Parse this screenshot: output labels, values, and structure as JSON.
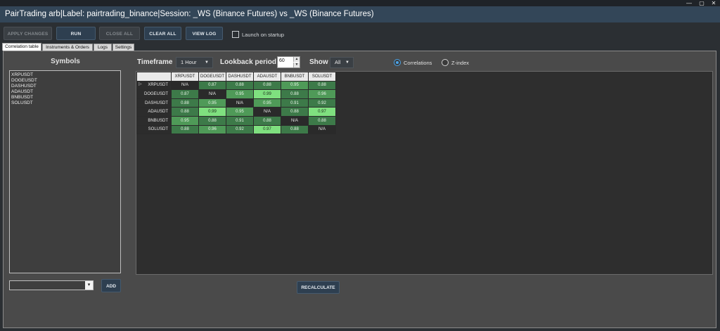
{
  "window": {
    "title": "PairTrading arb|Label: pairtrading_binance|Session: _WS (Binance Futures) vs _WS (Binance Futures)",
    "minimize": "—",
    "maximize": "▢",
    "close": "✕"
  },
  "toolbar": {
    "apply_changes": "APPLY CHANGES",
    "run": "RUN",
    "close_all": "CLOSE ALL",
    "clear_all": "CLEAR ALL",
    "view_log": "VIEW LOG",
    "launch_on_startup": "Launch on startup",
    "launch_on_startup_checked": false
  },
  "tabs": [
    "Correlation table",
    "Instruments & Orders",
    "Logs",
    "Settings"
  ],
  "active_tab": "Correlation table",
  "symbols": {
    "title": "Symbols",
    "items": [
      "XRPUSDT",
      "DOGEUSDT",
      "DASHUSDT",
      "ADAUSDT",
      "BNBUSDT",
      "SOLUSDT"
    ],
    "combo_value": "",
    "add_label": "ADD"
  },
  "controls": {
    "timeframe_label": "Timeframe",
    "timeframe_value": "1 Hour",
    "lookback_label": "Lookback period",
    "lookback_value": "60",
    "show_label": "Show",
    "show_value": "All",
    "mode_options": [
      "Correlations",
      "Z-index"
    ],
    "mode_selected": "Correlations",
    "recalculate": "RECALCULATE"
  },
  "matrix": {
    "columns": [
      "XRPUSDT",
      "DOGEUSDT",
      "DASHUSDT",
      "ADAUSDT",
      "BNBUSDT",
      "SOLUSDT"
    ],
    "rows": [
      {
        "label": "XRPUSDT",
        "marker": "▷",
        "cells": [
          "N/A",
          "0.87",
          "0.88",
          "0.88",
          "0.95",
          "0.88"
        ]
      },
      {
        "label": "DOGEUSDT",
        "marker": "",
        "cells": [
          "0.87",
          "N/A",
          "0.95",
          "0.99",
          "0.88",
          "0.96"
        ]
      },
      {
        "label": "DASHUSDT",
        "marker": "",
        "cells": [
          "0.88",
          "0.95",
          "N/A",
          "0.95",
          "0.91",
          "0.92"
        ]
      },
      {
        "label": "ADAUSDT",
        "marker": "",
        "cells": [
          "0.88",
          "0.99",
          "0.95",
          "N/A",
          "0.88",
          "0.97"
        ]
      },
      {
        "label": "BNBUSDT",
        "marker": "",
        "cells": [
          "0.95",
          "0.88",
          "0.91",
          "0.88",
          "N/A",
          "0.88"
        ]
      },
      {
        "label": "SOLUSDT",
        "marker": "",
        "cells": [
          "0.88",
          "0.96",
          "0.92",
          "0.97",
          "0.88",
          "N/A"
        ]
      }
    ],
    "colors": {
      "na": "#2a2a2a",
      "high": "#7fe07f",
      "mid": "#4f9a58",
      "low": "#3d7a49"
    }
  }
}
